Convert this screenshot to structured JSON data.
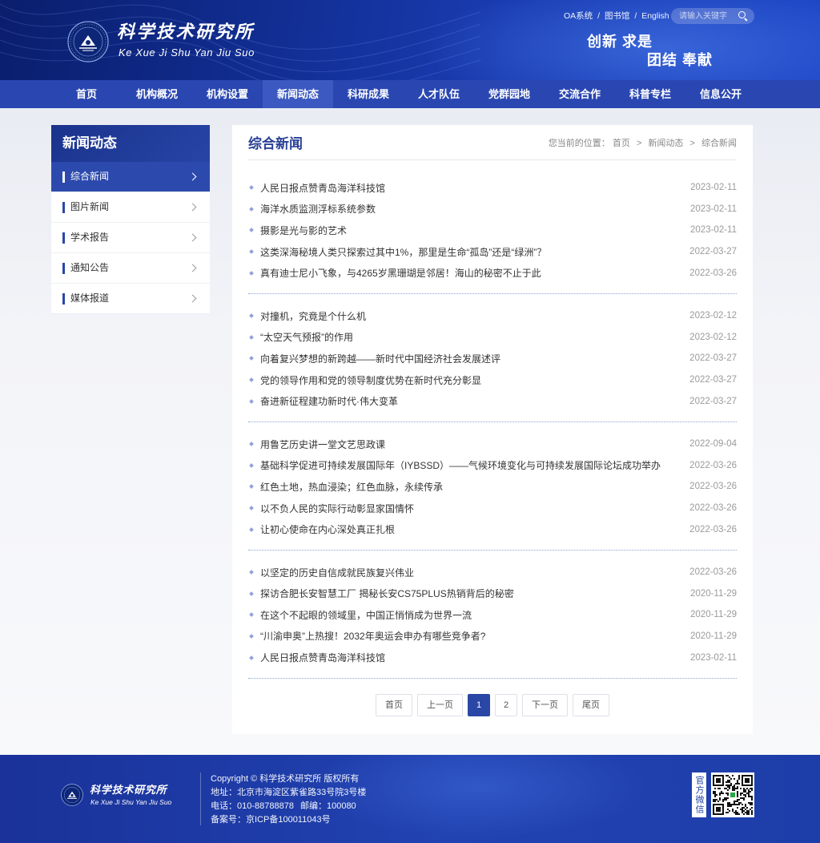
{
  "header": {
    "title": "科学技术研究所",
    "subtitle": "Ke Xue Ji Shu Yan Jiu Suo",
    "top_links": [
      "OA系统",
      "图书馆",
      "English"
    ],
    "link_separator": "/",
    "search": {
      "placeholder": "请输入关键字",
      "icon": "search-icon"
    },
    "slogan": [
      "创新 求是",
      "团结 奉献"
    ]
  },
  "nav": {
    "items": [
      "首页",
      "机构概况",
      "机构设置",
      "新闻动态",
      "科研成果",
      "人才队伍",
      "党群园地",
      "交流合作",
      "科普专栏",
      "信息公开"
    ],
    "active_index": 3
  },
  "sidebar": {
    "title": "新闻动态",
    "items": [
      "综合新闻",
      "图片新闻",
      "学术报告",
      "通知公告",
      "媒体报道"
    ],
    "active_index": 0,
    "item_icon": "chevron-right-icon"
  },
  "content": {
    "title": "综合新闻",
    "breadcrumb": {
      "prefix": "您当前的位置：",
      "items": [
        "首页",
        "新闻动态",
        "综合新闻"
      ],
      "separator": ">"
    },
    "news_groups": [
      [
        {
          "title": "人民日报点赞青岛海洋科技馆",
          "date": "2023-02-11"
        },
        {
          "title": "海洋水质监测浮标系统参数",
          "date": "2023-02-11"
        },
        {
          "title": "摄影是光与影的艺术",
          "date": "2023-02-11"
        },
        {
          "title": "这类深海秘境人类只探索过其中1%，那里是生命“孤岛”还是“绿洲”？",
          "date": "2022-03-27"
        },
        {
          "title": "真有迪士尼小飞象，与4265岁黑珊瑚是邻居！海山的秘密不止于此",
          "date": "2022-03-26"
        }
      ],
      [
        {
          "title": "对撞机，究竟是个什么机",
          "date": "2023-02-12"
        },
        {
          "title": "“太空天气预报”的作用",
          "date": "2023-02-12"
        },
        {
          "title": "向着复兴梦想的新跨越——新时代中国经济社会发展述评",
          "date": "2022-03-27"
        },
        {
          "title": "党的领导作用和党的领导制度优势在新时代充分彰显",
          "date": "2022-03-27"
        },
        {
          "title": "奋进新征程建功新时代·伟大变革",
          "date": "2022-03-27"
        }
      ],
      [
        {
          "title": "用鲁艺历史讲一堂文艺思政课",
          "date": "2022-09-04"
        },
        {
          "title": "基础科学促进可持续发展国际年（IYBSSD）——气候环境变化与可持续发展国际论坛成功举办",
          "date": "2022-03-26"
        },
        {
          "title": "红色土地，热血浸染；红色血脉，永续传承",
          "date": "2022-03-26"
        },
        {
          "title": "以不负人民的实际行动彰显家国情怀",
          "date": "2022-03-26"
        },
        {
          "title": "让初心使命在内心深处真正扎根",
          "date": "2022-03-26"
        }
      ],
      [
        {
          "title": "以坚定的历史自信成就民族复兴伟业",
          "date": "2022-03-26"
        },
        {
          "title": "探访合肥长安智慧工厂 揭秘长安CS75PLUS热销背后的秘密",
          "date": "2020-11-29"
        },
        {
          "title": "在这个不起眼的领域里，中国正悄悄成为世界一流",
          "date": "2020-11-29"
        },
        {
          "title": "“川渝申奥”上热搜！2032年奥运会申办有哪些竞争者?",
          "date": "2020-11-29"
        },
        {
          "title": "人民日报点赞青岛海洋科技馆",
          "date": "2023-02-11"
        }
      ]
    ]
  },
  "pagination": {
    "first": "首页",
    "prev": "上一页",
    "pages": [
      "1",
      "2"
    ],
    "current_page": 1,
    "next": "下一页",
    "last": "尾页"
  },
  "footer": {
    "logo_title": "科学技术研究所",
    "logo_subtitle": "Ke Xue Ji Shu Yan Jiu Suo",
    "copyright": "Copyright © 科学技术研究所 版权所有",
    "address": "地址：北京市海淀区紫雀路33号院3号楼",
    "phone": "电话：010-88788878",
    "postcode": "邮编：100080",
    "icp": "备案号：京ICP备100011043号",
    "wechat_label": "官方微信"
  },
  "colors": {
    "primary": "#2a47a6",
    "header_dark": "#0a1e6c",
    "nav_bg": "#2a47b1",
    "nav_active": "#3b59c0",
    "content_title": "#2a4196",
    "date_text": "#9a9a9a",
    "bullet": "#8ea3d6",
    "footer_bg": "#2143b2"
  }
}
